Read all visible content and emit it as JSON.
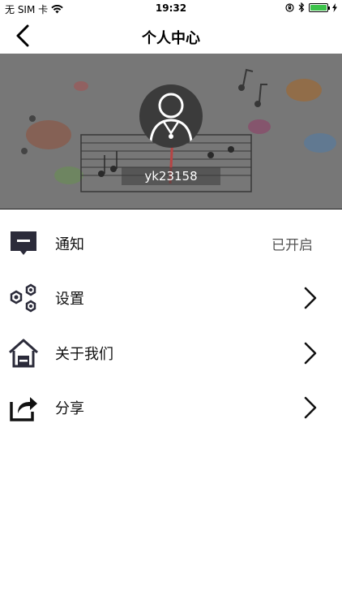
{
  "status_bar": {
    "carrier": "无 SIM 卡",
    "time": "19:32",
    "battery_color": "#3cc34a"
  },
  "nav": {
    "title": "个人中心",
    "back_icon": "chevron-left-icon"
  },
  "profile": {
    "username": "yk23158",
    "avatar_icon": "user-avatar-icon"
  },
  "menu": {
    "items": [
      {
        "label": "通知",
        "icon": "notification-icon",
        "value": "已开启"
      },
      {
        "label": "设置",
        "icon": "settings-icon"
      },
      {
        "label": "关于我们",
        "icon": "home-icon"
      },
      {
        "label": "分享",
        "icon": "share-icon"
      }
    ]
  }
}
